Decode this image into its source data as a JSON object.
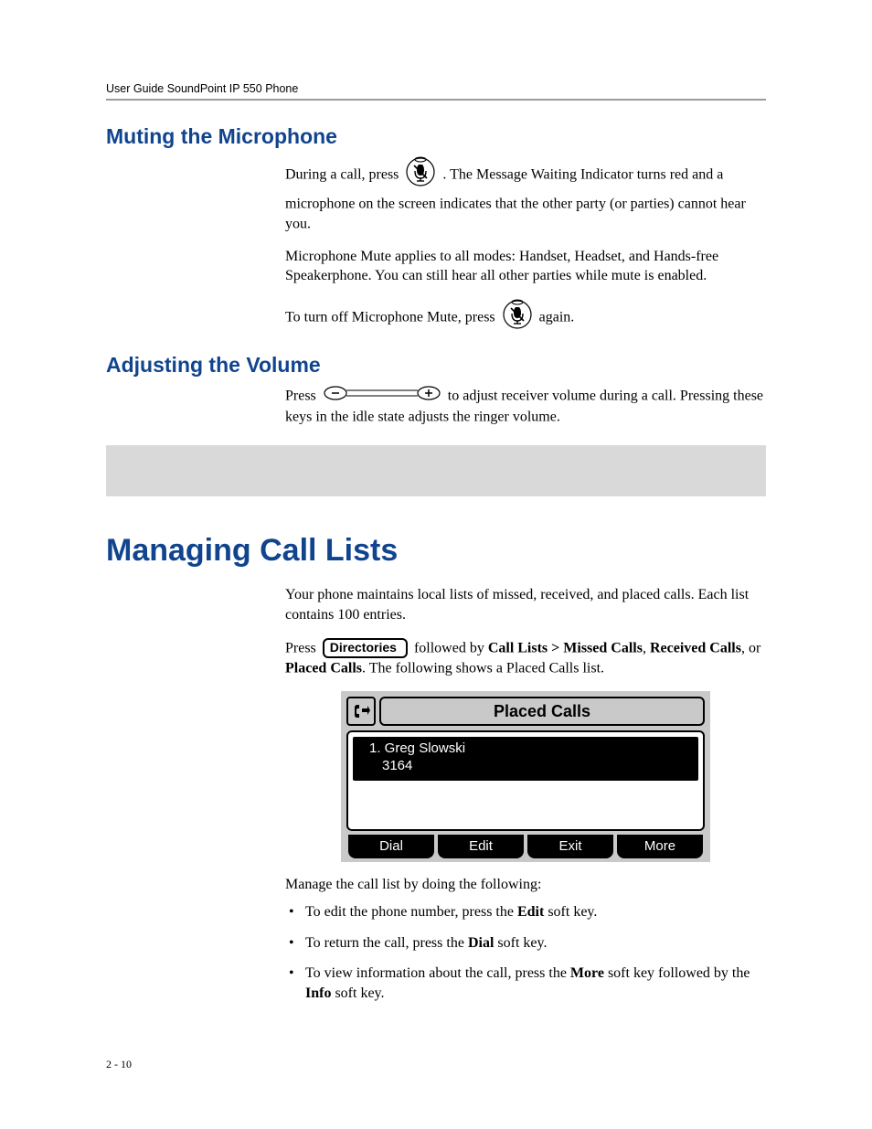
{
  "header": {
    "guide_title": "User Guide SoundPoint IP 550 Phone"
  },
  "sections": {
    "muting": {
      "heading": "Muting the Microphone",
      "p1_a": "During a call, press ",
      "p1_b": " . The Message Waiting Indicator turns red and a microphone on the screen indicates that the other party (or parties) cannot hear you.",
      "p2": "Microphone Mute applies to all modes: Handset, Headset, and Hands-free Speakerphone. You can still hear all other parties while mute is enabled.",
      "p3_a": "To turn off Microphone Mute, press ",
      "p3_b": " again."
    },
    "volume": {
      "heading": "Adjusting the Volume",
      "p1_a": "Press ",
      "p1_b": " to adjust receiver volume during a call. Pressing these keys in the idle state adjusts the ringer volume."
    },
    "call_lists": {
      "heading": "Managing Call Lists",
      "p1": "Your phone maintains local lists of missed, received, and placed calls. Each list contains 100 entries.",
      "p2_a": "Press ",
      "directories_label": "Directories",
      "p2_b": " followed by ",
      "p2_nav1": "Call Lists > Missed Calls",
      "p2_c": ", ",
      "p2_nav2": "Received Calls",
      "p2_d": ", or ",
      "p2_nav3": "Placed Calls",
      "p2_e": ". The following shows a Placed Calls list.",
      "screenshot": {
        "title": "Placed Calls",
        "entry_line1": "1. Greg Slowski",
        "entry_line2": "3164",
        "softkeys": [
          "Dial",
          "Edit",
          "Exit",
          "More"
        ]
      },
      "p3": "Manage the call list by doing the following:",
      "bullets": [
        {
          "a": "To edit the phone number, press the ",
          "b": "Edit",
          "c": " soft key."
        },
        {
          "a": "To return the call, press the ",
          "b": "Dial",
          "c": " soft key."
        },
        {
          "a": "To view information about the call, press the ",
          "b": "More",
          "c": " soft key followed by the ",
          "d": "Info",
          "e": " soft key."
        }
      ]
    }
  },
  "footer": {
    "page_number": "2 - 10"
  }
}
